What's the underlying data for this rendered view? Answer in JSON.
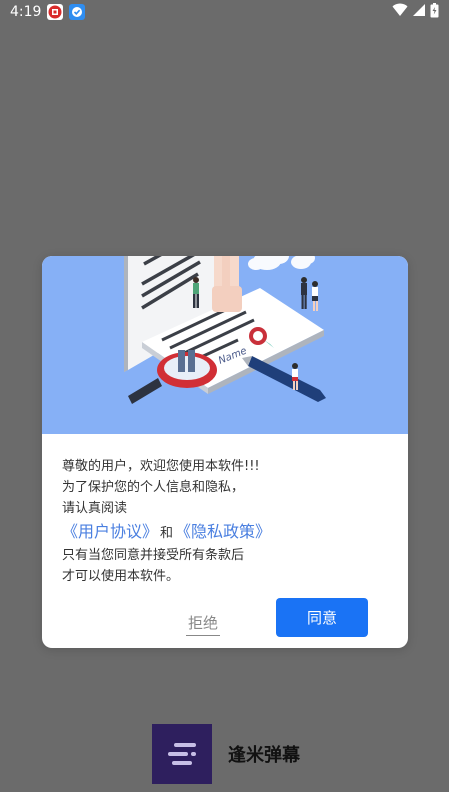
{
  "status_bar": {
    "time": "4:19",
    "icons": [
      "notification-app-red-icon",
      "notification-app-blue-icon",
      "wifi-icon",
      "signal-icon",
      "battery-icon"
    ]
  },
  "dialog": {
    "hero_illustration": "agreement-document-illustration",
    "hero_sign_text": "Name",
    "lines": [
      "尊敬的用户，欢迎您使用本软件!!!",
      "为了保护您的个人信息和隐私，",
      "请认真阅读"
    ],
    "user_agreement_link": "《用户协议》",
    "and_text": "和",
    "privacy_policy_link": "《隐私政策》",
    "closing_lines": [
      "只有当您同意并接受所有条款后",
      "才可以使用本软件。"
    ],
    "reject_label": "拒绝",
    "agree_label": "同意"
  },
  "colors": {
    "hero_bg": "#86b0f6",
    "agree_button": "#1a73f5",
    "link": "#4a7fe0",
    "overlay": "#6b6b6b"
  },
  "splash": {
    "app_name": "逢米弹幕",
    "logo_icon": "danmaku-lines-icon"
  }
}
